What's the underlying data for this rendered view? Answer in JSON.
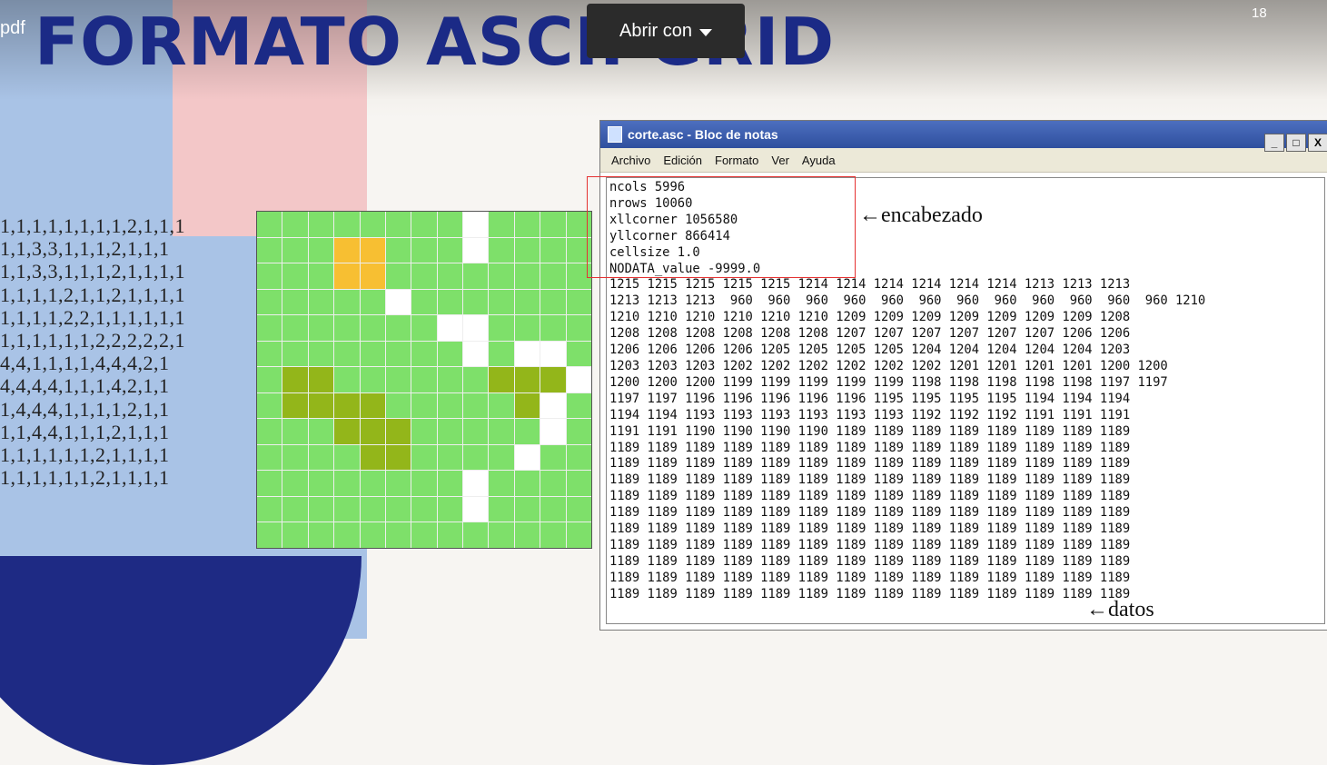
{
  "top_bar": {
    "pdf_label": "pdf",
    "title": "FORMATO ASCII GRID",
    "open_with_label": "Abrir con",
    "page_number": "18"
  },
  "left_matrix": {
    "rows": [
      "1,1,1,1,1,1,1,1,2,1,1,1",
      "1,1,3,3,1,1,1,2,1,1,1",
      "1,1,3,3,1,1,1,2,1,1,1,1",
      "1,1,1,1,2,1,1,2,1,1,1,1",
      "1,1,1,1,2,2,1,1,1,1,1,1",
      "1,1,1,1,1,1,2,2,2,2,2,1",
      "4,4,1,1,1,1,4,4,4,2,1",
      "4,4,4,4,1,1,1,4,2,1,1",
      "1,4,4,4,1,1,1,1,2,1,1",
      "1,1,4,4,1,1,1,2,1,1,1",
      "1,1,1,1,1,1,2,1,1,1,1",
      "1,1,1,1,1,1,2,1,1,1,1"
    ]
  },
  "grid_figure": {
    "colors": {
      "1": "#7ee06a",
      "2": "#ffffff",
      "3": "#f7bf32",
      "4": "#93b61a"
    },
    "cells": [
      [
        1,
        1,
        1,
        1,
        1,
        1,
        1,
        1,
        2,
        1,
        1,
        1,
        1
      ],
      [
        1,
        1,
        1,
        3,
        3,
        1,
        1,
        1,
        2,
        1,
        1,
        1,
        1
      ],
      [
        1,
        1,
        1,
        3,
        3,
        1,
        1,
        1,
        1,
        1,
        1,
        1,
        1
      ],
      [
        1,
        1,
        1,
        1,
        1,
        2,
        1,
        1,
        1,
        1,
        1,
        1,
        1
      ],
      [
        1,
        1,
        1,
        1,
        1,
        1,
        1,
        2,
        2,
        1,
        1,
        1,
        1
      ],
      [
        1,
        1,
        1,
        1,
        1,
        1,
        1,
        1,
        2,
        1,
        2,
        2,
        1
      ],
      [
        1,
        4,
        4,
        1,
        1,
        1,
        1,
        1,
        1,
        4,
        4,
        4,
        2
      ],
      [
        1,
        4,
        4,
        4,
        4,
        1,
        1,
        1,
        1,
        1,
        4,
        2,
        1
      ],
      [
        1,
        1,
        1,
        4,
        4,
        4,
        1,
        1,
        1,
        1,
        1,
        2,
        1
      ],
      [
        1,
        1,
        1,
        1,
        4,
        4,
        1,
        1,
        1,
        1,
        2,
        1,
        1
      ],
      [
        1,
        1,
        1,
        1,
        1,
        1,
        1,
        1,
        2,
        1,
        1,
        1,
        1
      ],
      [
        1,
        1,
        1,
        1,
        1,
        1,
        1,
        1,
        2,
        1,
        1,
        1,
        1
      ],
      [
        1,
        1,
        1,
        1,
        1,
        1,
        1,
        1,
        1,
        1,
        1,
        1,
        1
      ]
    ]
  },
  "notepad": {
    "title": "corte.asc - Bloc de notas",
    "window_buttons": [
      "_",
      "□",
      "X"
    ],
    "menu": [
      "Archivo",
      "Edición",
      "Formato",
      "Ver",
      "Ayuda"
    ],
    "content": "ncols 5996\nnrows 10060\nxllcorner 1056580\nyllcorner 866414\ncellsize 1.0\nNODATA_value -9999.0\n1215 1215 1215 1215 1215 1214 1214 1214 1214 1214 1214 1213 1213 1213\n1213 1213 1213  960  960  960  960  960  960  960  960  960  960  960  960 1210\n1210 1210 1210 1210 1210 1210 1209 1209 1209 1209 1209 1209 1209 1208\n1208 1208 1208 1208 1208 1208 1207 1207 1207 1207 1207 1207 1206 1206\n1206 1206 1206 1206 1205 1205 1205 1205 1204 1204 1204 1204 1204 1203\n1203 1203 1203 1202 1202 1202 1202 1202 1202 1201 1201 1201 1201 1200 1200\n1200 1200 1200 1199 1199 1199 1199 1199 1198 1198 1198 1198 1198 1197 1197\n1197 1197 1196 1196 1196 1196 1196 1195 1195 1195 1195 1194 1194 1194\n1194 1194 1193 1193 1193 1193 1193 1193 1192 1192 1192 1191 1191 1191\n1191 1191 1190 1190 1190 1190 1189 1189 1189 1189 1189 1189 1189 1189\n1189 1189 1189 1189 1189 1189 1189 1189 1189 1189 1189 1189 1189 1189\n1189 1189 1189 1189 1189 1189 1189 1189 1189 1189 1189 1189 1189 1189\n1189 1189 1189 1189 1189 1189 1189 1189 1189 1189 1189 1189 1189 1189\n1189 1189 1189 1189 1189 1189 1189 1189 1189 1189 1189 1189 1189 1189\n1189 1189 1189 1189 1189 1189 1189 1189 1189 1189 1189 1189 1189 1189\n1189 1189 1189 1189 1189 1189 1189 1189 1189 1189 1189 1189 1189 1189\n1189 1189 1189 1189 1189 1189 1189 1189 1189 1189 1189 1189 1189 1189\n1189 1189 1189 1189 1189 1189 1189 1189 1189 1189 1189 1189 1189 1189\n1189 1189 1189 1189 1189 1189 1189 1189 1189 1189 1189 1189 1189 1189\n1189 1189 1189 1189 1189 1189 1189 1189 1189 1189 1189 1189 1189 1189"
  },
  "annotations": {
    "header_label": "←encabezado",
    "data_label": "←datos"
  }
}
